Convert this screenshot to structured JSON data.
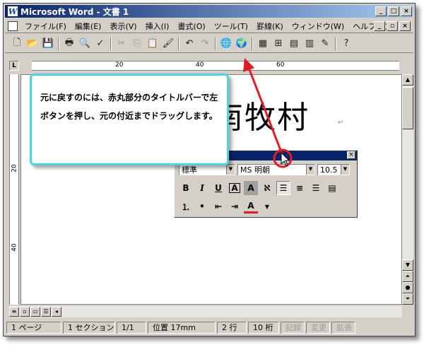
{
  "window": {
    "title": "Microsoft Word - 文書 1",
    "app_icon": "W"
  },
  "window_buttons": [
    "_",
    "□",
    "×"
  ],
  "menu": {
    "items": [
      "ファイル(F)",
      "編集(E)",
      "表示(V)",
      "挿入(I)",
      "書式(O)",
      "ツール(T)",
      "罫線(K)",
      "ウィンドウ(W)",
      "ヘルプ(H)"
    ],
    "doc_buttons": [
      "_",
      "▫",
      "×"
    ]
  },
  "toolbar": {
    "icons": [
      "new-document-icon",
      "open-folder-icon",
      "save-icon",
      "print-icon",
      "print-preview-icon",
      "spelling-icon",
      "cut-icon",
      "copy-icon",
      "paste-icon",
      "format-painter-icon",
      "undo-icon",
      "redo-icon",
      "hyperlink-icon",
      "web-toolbar-icon",
      "tables-borders-icon",
      "insert-table-icon",
      "insert-excel-icon",
      "columns-icon",
      "drawing-icon",
      "help-icon"
    ]
  },
  "ruler": {
    "corner": "L",
    "numbers": [
      "20",
      "40",
      "60"
    ]
  },
  "vruler": {
    "numbers": [
      "20",
      "40"
    ]
  },
  "document": {
    "heading": "南牧村",
    "para_mark": "↵"
  },
  "callout": {
    "text": "元に戻すのには、赤丸部分のタイトルバーで左ボタンを押し、元の付近までドラッグします。"
  },
  "format_toolbar": {
    "style": "標準",
    "font": "MS 明朝",
    "size": "10.5",
    "row2": [
      "B",
      "I",
      "U",
      "A",
      "A",
      "ℵ"
    ],
    "close": "×"
  },
  "statusbar": {
    "page": "1 ページ",
    "section": "1 セクション",
    "pages": "1/1",
    "position": "位置 17mm",
    "line": "2 行",
    "column": "10 桁",
    "rec": "記録",
    "trk": "変更",
    "ext": "拡張"
  },
  "colors": {
    "titlebar": "#0a246a",
    "callout_border": "#4fd3e6",
    "arrow": "#e01c24"
  }
}
